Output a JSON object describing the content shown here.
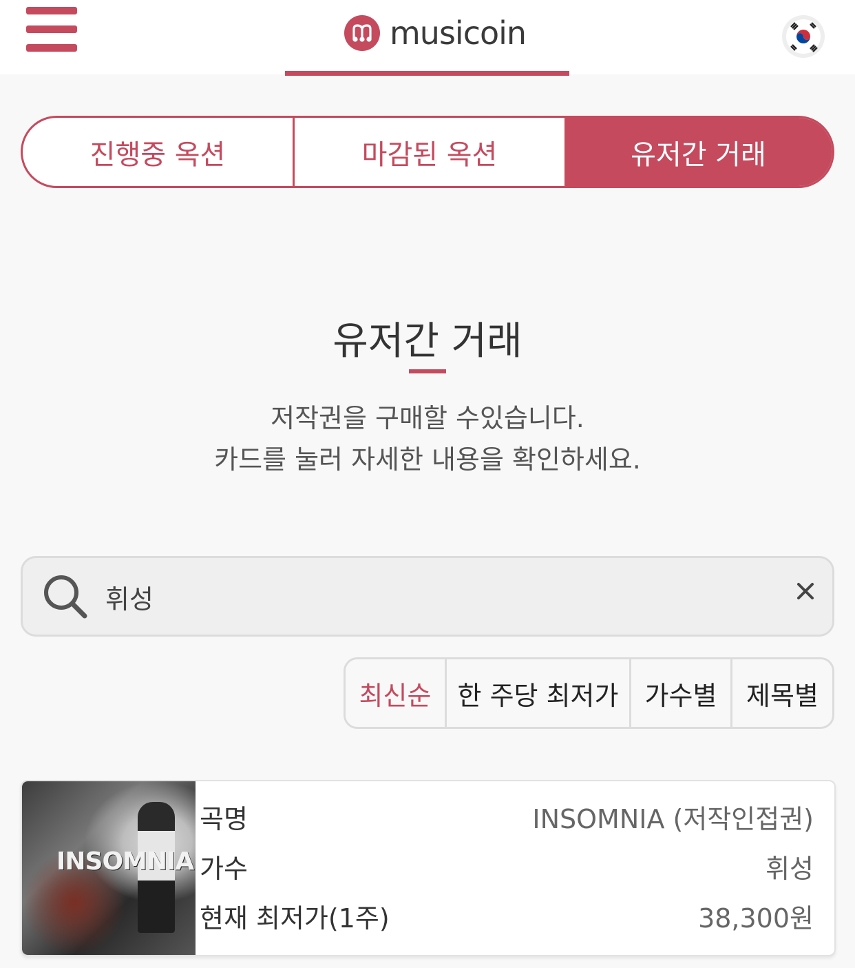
{
  "header": {
    "logo_text": "musicoin",
    "menu_icon": "hamburger-menu-icon",
    "language_icon": "korea-flag-icon",
    "accent_color": "#c54a5e"
  },
  "tabs": [
    {
      "label": "진행중 옥션",
      "active": false
    },
    {
      "label": "마감된 옥션",
      "active": false
    },
    {
      "label": "유저간 거래",
      "active": true
    }
  ],
  "section": {
    "title": "유저간 거래",
    "description_line1": "저작권을 구매할 수있습니다.",
    "description_line2": "카드를 눌러 자세한 내용을 확인하세요."
  },
  "search": {
    "value": "휘성",
    "icon": "search-icon",
    "clear_icon": "close-icon"
  },
  "sort": {
    "options": [
      "최신순",
      "한 주당 최저가",
      "가수별",
      "제목별"
    ],
    "selected": "최신순"
  },
  "cards": [
    {
      "album_art_text": "INSOMNIA",
      "rows": [
        {
          "label": "곡명",
          "value": "INSOMNIA (저작인접권)"
        },
        {
          "label": "가수",
          "value": "휘성"
        },
        {
          "label": "현재 최저가(1주)",
          "value": "38,300원"
        }
      ]
    }
  ]
}
